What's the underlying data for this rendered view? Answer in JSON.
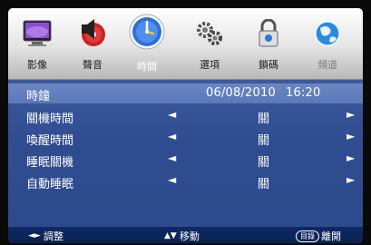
{
  "tabs": [
    {
      "label": "影像",
      "icon": "picture-icon"
    },
    {
      "label": "聲音",
      "icon": "sound-icon"
    },
    {
      "label": "時間",
      "icon": "clock-icon"
    },
    {
      "label": "選項",
      "icon": "gears-icon"
    },
    {
      "label": "鎖碼",
      "icon": "lock-icon"
    },
    {
      "label": "頻道",
      "icon": "globe-icon"
    }
  ],
  "selected_tab": "時間",
  "clock": {
    "label": "時鐘",
    "date": "06/08/2010",
    "time": "16:20"
  },
  "settings": [
    {
      "label": "關機時間",
      "value": "關"
    },
    {
      "label": "喚醒時間",
      "value": "關"
    },
    {
      "label": "睡眠關機",
      "value": "關"
    },
    {
      "label": "自動睡眠",
      "value": "關"
    }
  ],
  "arrows": {
    "left": "◄",
    "right": "►"
  },
  "footer": {
    "adjust": {
      "keys": "◄►",
      "label": "調整"
    },
    "move": {
      "keys": "▲▼",
      "label": "移動"
    },
    "exit": {
      "key": "目錄",
      "label": "離開"
    }
  },
  "colors": {
    "accent": "#3b579c",
    "footer": "#0e2a63",
    "highlight": "#6a86c2"
  }
}
